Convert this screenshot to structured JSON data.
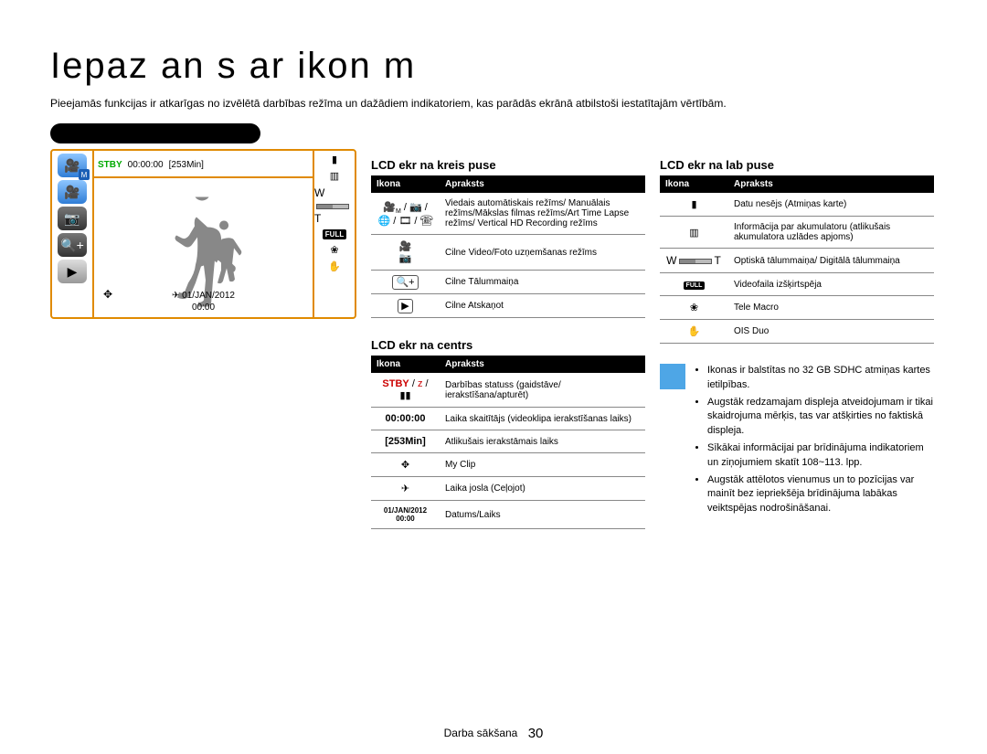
{
  "title": "Iepaz  an s ar ikon m",
  "intro": "Pieejamās funkcijas ir atkarīgas no izvēlētā darbības režīma un dažādiem indikatoriem, kas parādās ekrānā atbilstoši iestatītajām vērtībām.",
  "lcd": {
    "stby": "STBY",
    "counter": "00:00:00",
    "remain": "[253Min]",
    "date": "01/JAN/2012",
    "time": "00:00"
  },
  "left_table": {
    "title": "LCD ekr  na kreis   puse",
    "head": {
      "ikona": "Ikona",
      "apraksts": "Apraksts"
    },
    "rows": [
      {
        "desc": "Viedais automātiskais režīms/ Manuālais režīms/Mākslas filmas režīms/Art Time Lapse režīms/ Vertical HD Recording režīms"
      },
      {
        "desc": "Cilne Video/Foto uzņemšanas režīms"
      },
      {
        "desc": "Cilne Tālummaiņa"
      },
      {
        "desc": "Cilne Atskaņot"
      }
    ]
  },
  "center_table": {
    "title": "LCD ekr  na centrs",
    "head": {
      "ikona": "Ikona",
      "apraksts": "Apraksts"
    },
    "rows": [
      {
        "desc": "Darbības statuss (gaidstāve/ ierakstīšana/apturēt)"
      },
      {
        "icon": "00:00:00",
        "desc": "Laika skaitītājs (videoklipa ierakstīšanas laiks)"
      },
      {
        "icon": "[253Min]",
        "desc": "Atlikušais ierakstāmais laiks"
      },
      {
        "desc": "My Clip"
      },
      {
        "desc": "Laika josla (Ceļojot)"
      },
      {
        "icon_line1": "01/JAN/2012",
        "icon_line2": "00:00",
        "desc": "Datums/Laiks"
      }
    ],
    "stby_label": "STBY",
    "stby_sep": " / ",
    "stby_rec": "z",
    "stby_pause": " / "
  },
  "right_table": {
    "title": "LCD ekr  na lab   puse",
    "head": {
      "ikona": "Ikona",
      "apraksts": "Apraksts"
    },
    "rows": [
      {
        "desc": "Datu nesējs (Atmiņas karte)"
      },
      {
        "desc": "Informācija par akumulatoru (atlikušais akumulatora uzlādes apjoms)"
      },
      {
        "desc": "Optiskā tālummaiņa/ Digitālā tālummaiņa"
      },
      {
        "desc": "Videofaila izšķirtspēja"
      },
      {
        "desc": "Tele Macro"
      },
      {
        "desc": "OIS Duo"
      }
    ]
  },
  "notes": {
    "items": [
      "Ikonas ir balstītas no 32 GB SDHC atmiņas kartes ietilpības.",
      "Augstāk redzamajam displeja atveidojumam ir tikai skaidrojuma mērķis, tas var atšķirties no faktiskā displeja.",
      "Sīkākai informācijai par brīdinājuma indikatoriem un ziņojumiem skatīt 108~113. lpp.",
      "Augstāk attēlotos vienumus un to pozīcijas var mainīt bez iepriekšēja brīdinājuma labākas veiktspējas nodrošināšanai."
    ]
  },
  "footer": {
    "label": "Darba sākšana",
    "page": "30"
  },
  "glyphs": {
    "camcorder": "🎥",
    "camera": "📷",
    "globe": "🌐",
    "film": "🎞",
    "phone": "☎",
    "zoom": "🔍+",
    "play": "▶",
    "sd": "▮",
    "battery": "▥",
    "full": "FULL",
    "flower": "❀",
    "hand": "✋",
    "pine": "✥",
    "airplane": "✈"
  }
}
